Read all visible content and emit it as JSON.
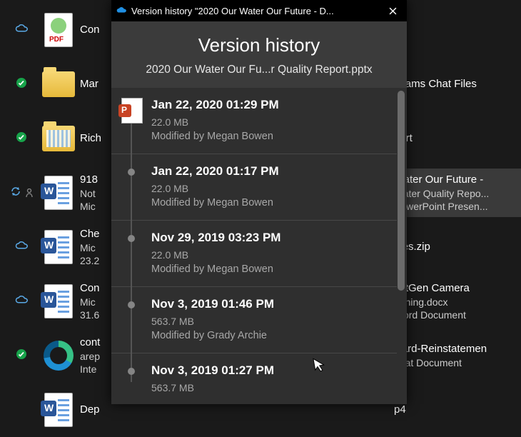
{
  "dialog": {
    "titlebar": "Version history \"2020 Our Water Our Future - D...",
    "heading": "Version history",
    "filename": "2020 Our Water Our Fu...r Quality Report.pptx"
  },
  "versions": [
    {
      "datetime": "Jan 22, 2020 01:29 PM",
      "size": "22.0 MB",
      "modified_by": "Modified by Megan Bowen",
      "is_current": true
    },
    {
      "datetime": "Jan 22, 2020 01:17 PM",
      "size": "22.0 MB",
      "modified_by": "Modified by Megan Bowen",
      "is_current": false
    },
    {
      "datetime": "Nov 29, 2019 03:23 PM",
      "size": "22.0 MB",
      "modified_by": "Modified by Megan Bowen",
      "is_current": false
    },
    {
      "datetime": "Nov  3, 2019 01:46 PM",
      "size": "563.7 MB",
      "modified_by": "Modified by Grady Archie",
      "is_current": false
    },
    {
      "datetime": "Nov  3, 2019 01:27 PM",
      "size": "563.7 MB",
      "modified_by": "",
      "is_current": false
    }
  ],
  "files": [
    {
      "status": "cloud",
      "icon": "pdf",
      "name": "Con",
      "right_a": "",
      "right_b": ""
    },
    {
      "status": "ok",
      "icon": "folder",
      "name": "Mar",
      "right_a": "Teams Chat Files",
      "right_b": ""
    },
    {
      "status": "ok",
      "icon": "folder-full",
      "name": "Rich",
      "right_a": "port",
      "right_b": ""
    },
    {
      "status": "sync",
      "icon": "word",
      "name": "918",
      "name2": "Not",
      "name3": "Mic",
      "right_a": "Water Our Future -",
      "right_b": "Water Quality Repo...",
      "right_c": "PowerPoint Presen...",
      "selected": true
    },
    {
      "status": "cloud",
      "icon": "word",
      "name": "Che",
      "name2": "Mic",
      "name3": "23.2",
      "right_a": "ples.zip",
      "right_b": ""
    },
    {
      "status": "cloud",
      "icon": "word",
      "name": "Con",
      "name2": "Mic",
      "name3": "31.6",
      "right_a": "extGen Camera",
      "right_b": "anning.docx",
      "right_c": "Word Document"
    },
    {
      "status": "ok",
      "icon": "edge",
      "name": "cont",
      "name2": "arep",
      "name3": "Inte",
      "right_a": "Card-Reinstatemen",
      "right_b": "",
      "right_c": "obat Document"
    },
    {
      "status": "",
      "icon": "word",
      "name": "Dep",
      "right_a": "p4",
      "right_b": ""
    }
  ]
}
